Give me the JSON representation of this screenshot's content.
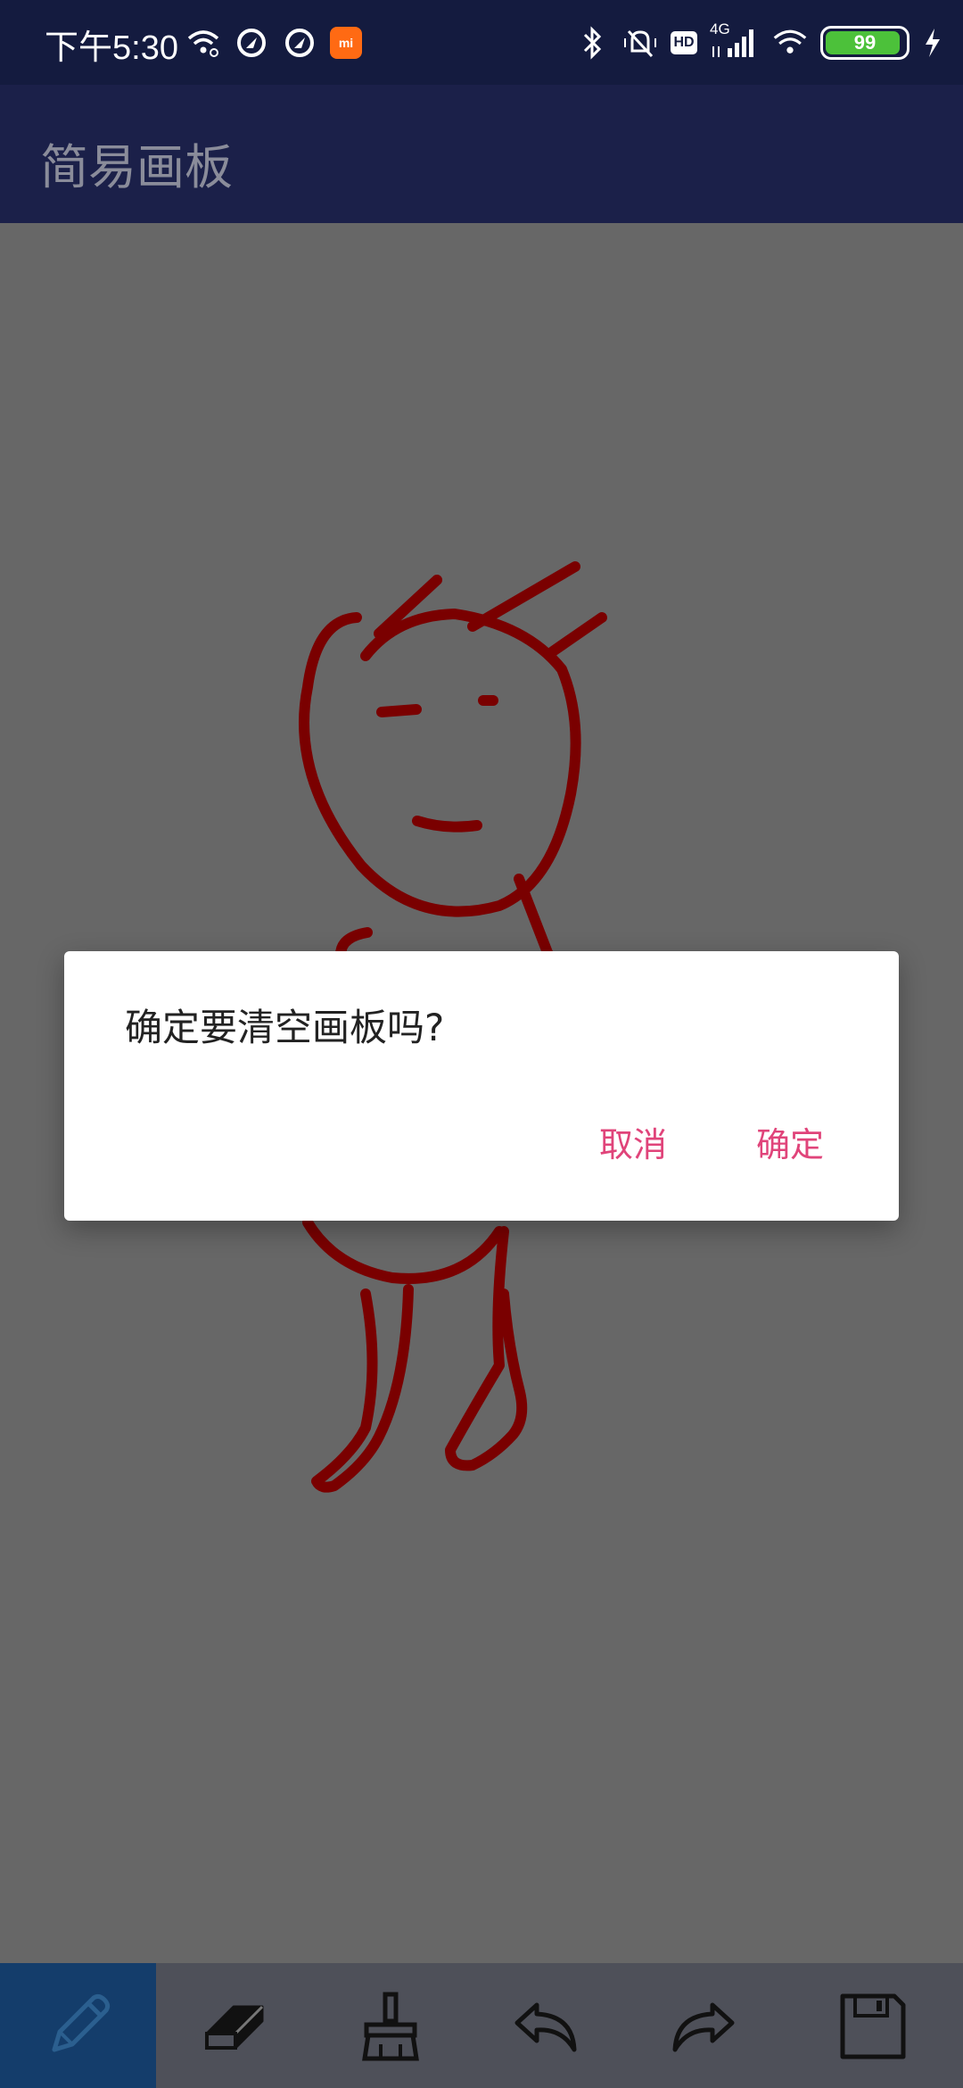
{
  "status_bar": {
    "time": "下午5:30",
    "network_label": "4G",
    "hd_label": "HD",
    "battery": "99",
    "app_badge": "mi",
    "icons_left": [
      "wifi-link-icon",
      "location-icon",
      "location-icon",
      "mi-app-icon"
    ],
    "icons_right": [
      "bluetooth-icon",
      "mute-vibrate-icon",
      "hd-icon",
      "signal-4g-icon",
      "wifi-icon",
      "battery-icon",
      "charging-icon"
    ]
  },
  "app_bar": {
    "title": "简易画板"
  },
  "dialog": {
    "message": "确定要清空画板吗?",
    "cancel_label": "取消",
    "confirm_label": "确定"
  },
  "toolbar": {
    "tools": [
      "pencil-icon",
      "eraser-icon",
      "broom-icon",
      "undo-icon",
      "redo-icon",
      "save-icon"
    ],
    "active_tool": "pencil-icon"
  },
  "colors": {
    "status_bar": "#141b3f",
    "app_bar": "#1b2049",
    "canvas": "#676767",
    "stroke": "#7a0000",
    "accent": "#e0447a",
    "toolbar": "#4e5059",
    "active_tool": "#143d6b"
  }
}
